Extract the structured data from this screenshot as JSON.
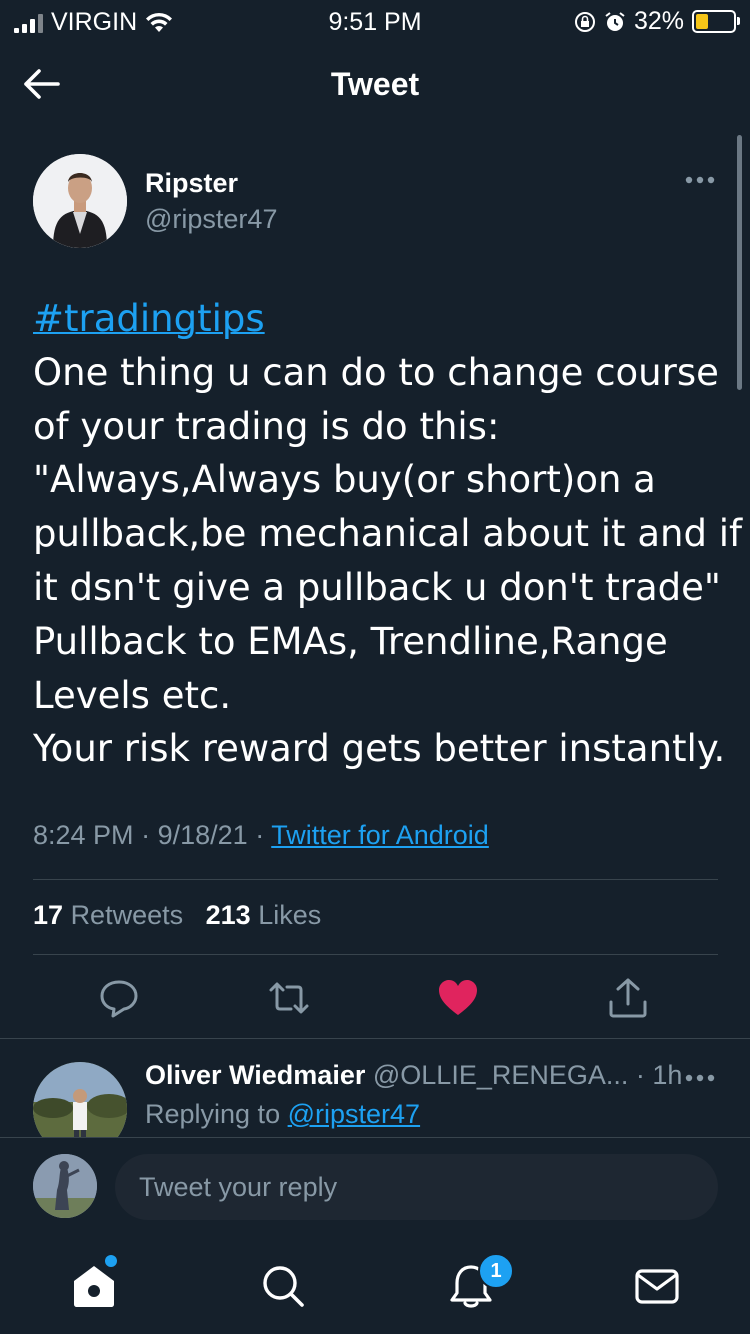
{
  "status_bar": {
    "carrier": "VIRGIN",
    "time": "9:51 PM",
    "battery_percent": "32%",
    "battery_level": 0.32,
    "icons": [
      "signal-icon",
      "wifi-icon",
      "orientation-lock-icon",
      "alarm-icon",
      "battery-icon"
    ]
  },
  "header": {
    "back_icon": "arrow-left-icon",
    "title": "Tweet"
  },
  "tweet": {
    "author_name": "Ripster",
    "author_handle": "@ripster47",
    "hashtag": "#tradingtips",
    "lines": [
      "One thing u can do to change course",
      "of your trading is do this:",
      "\"Always,Always buy(or short)on a",
      "pullback,be mechanical about it and if",
      "it dsn't give a pullback u don't trade\"",
      "Pullback to EMAs, Trendline,Range",
      "Levels etc.",
      "Your risk reward gets better instantly."
    ],
    "time": "8:24 PM",
    "date": "9/18/21",
    "separator": "·",
    "source": "Twitter for Android",
    "retweets_count": "17",
    "retweets_label": "Retweets",
    "likes_count": "213",
    "likes_label": "Likes",
    "liked": true,
    "colors": {
      "accent": "#1da1f2",
      "like": "#e0245e",
      "background": "#15202b"
    }
  },
  "reply": {
    "author_name": "Oliver Wiedmaier",
    "author_handle": "@OLLIE_RENEGA...",
    "separator": "·",
    "time_ago": "1h",
    "replying_prefix": "Replying to",
    "replying_to": "@ripster47"
  },
  "compose": {
    "placeholder": "Tweet your reply"
  },
  "tab_bar": {
    "items": [
      "home-icon",
      "search-icon",
      "notifications-icon",
      "messages-icon"
    ],
    "notification_badge": "1"
  }
}
